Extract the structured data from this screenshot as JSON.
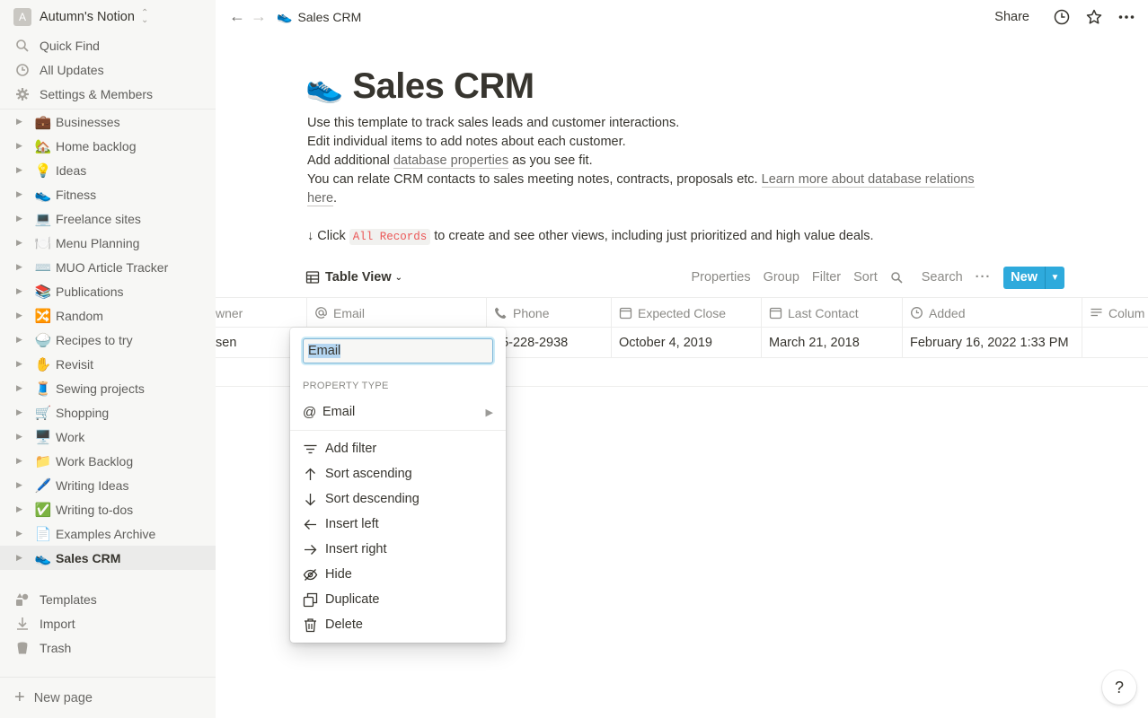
{
  "workspace": {
    "initial": "A",
    "name": "Autumn's Notion"
  },
  "sidebar_top": [
    {
      "label": "Quick Find",
      "icon": "search-icon"
    },
    {
      "label": "All Updates",
      "icon": "clock-icon"
    },
    {
      "label": "Settings & Members",
      "icon": "gear-icon"
    }
  ],
  "sidebar_pages": [
    {
      "emoji": "💼",
      "label": "Businesses"
    },
    {
      "emoji": "🏡",
      "label": "Home backlog"
    },
    {
      "emoji": "💡",
      "label": "Ideas"
    },
    {
      "emoji": "👟",
      "label": "Fitness"
    },
    {
      "emoji": "💻",
      "label": "Freelance sites"
    },
    {
      "emoji": "🍽️",
      "label": "Menu Planning"
    },
    {
      "emoji": "⌨️",
      "label": "MUO Article Tracker"
    },
    {
      "emoji": "📚",
      "label": "Publications"
    },
    {
      "emoji": "🔀",
      "label": "Random"
    },
    {
      "emoji": "🍚",
      "label": "Recipes to try"
    },
    {
      "emoji": "✋",
      "label": "Revisit"
    },
    {
      "emoji": "🧵",
      "label": "Sewing projects"
    },
    {
      "emoji": "🛒",
      "label": "Shopping"
    },
    {
      "emoji": "🖥️",
      "label": "Work"
    },
    {
      "emoji": "📁",
      "label": "Work Backlog"
    },
    {
      "emoji": "🖊️",
      "label": "Writing Ideas"
    },
    {
      "emoji": "✅",
      "label": "Writing to-dos"
    },
    {
      "emoji": "📄",
      "label": "Examples Archive"
    },
    {
      "emoji": "👟",
      "label": "Sales CRM"
    }
  ],
  "sidebar_bottom": [
    {
      "label": "Templates",
      "icon": "shapes-icon"
    },
    {
      "label": "Import",
      "icon": "download-icon"
    },
    {
      "label": "Trash",
      "icon": "trash-icon"
    }
  ],
  "new_page": "New page",
  "breadcrumb": {
    "emoji": "👟",
    "label": "Sales CRM"
  },
  "topbar": {
    "share": "Share"
  },
  "page": {
    "emoji": "👟",
    "title": "Sales CRM",
    "line1": "Use this template to track sales leads and customer interactions.",
    "line2": "Edit individual items to add notes about each customer.",
    "line3_a": "Add additional ",
    "line3_link": "database properties",
    "line3_b": " as you see fit.",
    "line4_a": "You can relate CRM contacts to sales meeting notes, contracts, proposals etc. ",
    "line4_link": "Learn more about database relations here",
    "line4_b": ".",
    "line5_a": "↓ Click ",
    "line5_code": "All Records",
    "line5_b": " to create and see other views, including just prioritized and high value deals."
  },
  "view": {
    "name": "Table View",
    "properties": "Properties",
    "group": "Group",
    "filter": "Filter",
    "sort": "Sort",
    "search": "Search",
    "new": "New"
  },
  "table": {
    "headers": [
      "wner",
      "Email",
      "Phone",
      "Expected Close",
      "Last Contact",
      "Added",
      "Colum"
    ],
    "row": [
      "sen",
      "",
      "15-228-2938",
      "October 4, 2019",
      "March 21, 2018",
      "February 16, 2022 1:33 PM",
      ""
    ]
  },
  "menu": {
    "field_value": "Email",
    "section": "PROPERTY TYPE",
    "property_type": "Email",
    "items": [
      "Add filter",
      "Sort ascending",
      "Sort descending",
      "Insert left",
      "Insert right",
      "Hide",
      "Duplicate",
      "Delete"
    ]
  },
  "help": "?"
}
